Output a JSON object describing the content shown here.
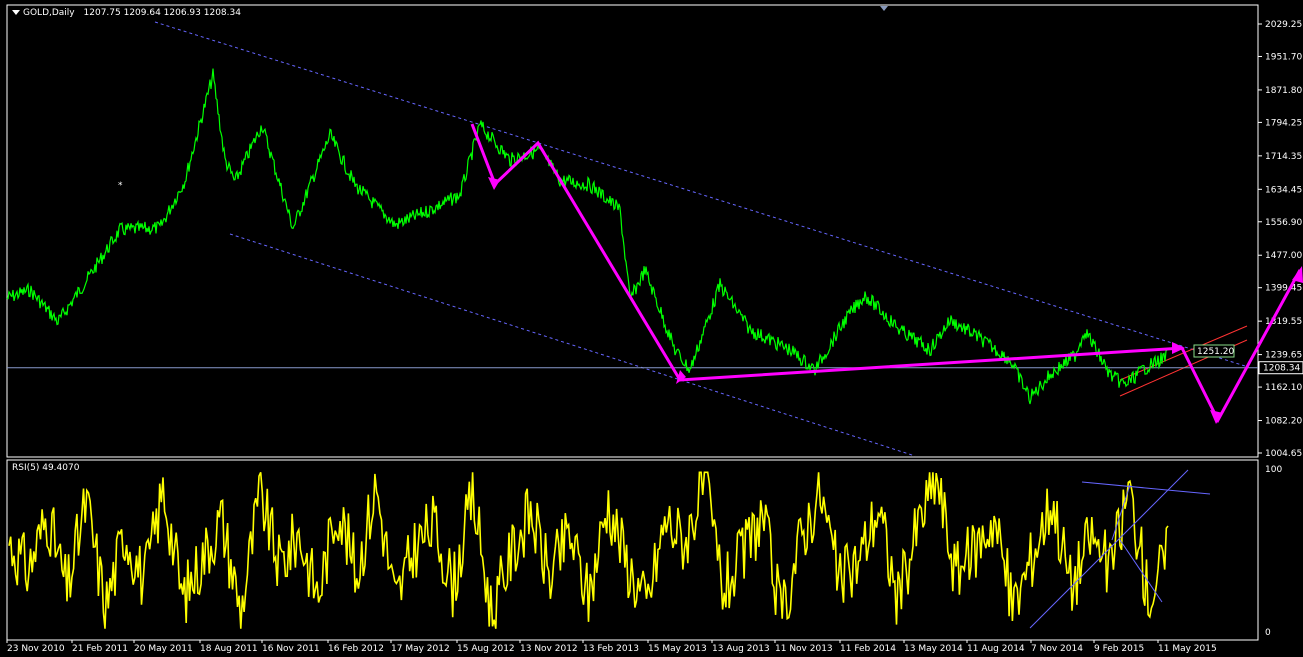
{
  "header": {
    "symbol": "GOLD,Daily",
    "ohlc": "1207.75 1209.64 1206.93 1208.34"
  },
  "indicator": {
    "label": "RSI(5) 49.4070",
    "scale_top": "100",
    "scale_bottom": "0"
  },
  "price_axis": {
    "ticks": [
      "2029.25",
      "1951.70",
      "1871.80",
      "1794.25",
      "1714.35",
      "1634.45",
      "1556.90",
      "1477.00",
      "1399.45",
      "1319.55",
      "1239.65",
      "1162.10",
      "1082.20",
      "1004.65"
    ],
    "current_price": "1208.34",
    "annotation": "1251.20"
  },
  "date_axis": {
    "labels": [
      "23 Nov 2010",
      "21 Feb 2011",
      "20 May 2011",
      "18 Aug 2011",
      "16 Nov 2011",
      "16 Feb 2012",
      "17 May 2012",
      "15 Aug 2012",
      "13 Nov 2012",
      "13 Feb 2013",
      "15 May 2013",
      "13 Aug 2013",
      "11 Nov 2013",
      "11 Feb 2014",
      "13 May 2014",
      "11 Aug 2014",
      "7 Nov 2014",
      "9 Feb 2015",
      "11 May 2015"
    ]
  },
  "colors": {
    "price_line": "#00ff00",
    "rsi_line": "#ffff00",
    "projection": "#ff00ff",
    "channel": "#6666ff",
    "red_channel": "#ff3333",
    "grid_frame": "#ffffff"
  },
  "chart_data": [
    {
      "type": "line",
      "title": "GOLD,Daily",
      "series": [
        {
          "name": "GOLD,Daily",
          "x": [
            "23 Nov 2010",
            "21 Feb 2011",
            "20 May 2011",
            "18 Aug 2011",
            "6 Sep 2011",
            "16 Nov 2011",
            "29 Dec 2011",
            "16 Feb 2012",
            "17 May 2012",
            "15 Aug 2012",
            "5 Oct 2012",
            "13 Nov 2012",
            "13 Feb 2013",
            "15 Apr 2013",
            "15 May 2013",
            "28 Jun 2013",
            "13 Aug 2013",
            "28 Aug 2013",
            "11 Nov 2013",
            "31 Dec 2013",
            "11 Feb 2014",
            "17 Mar 2014",
            "13 May 2014",
            "11 Aug 2014",
            "7 Nov 2014",
            "22 Jan 2015",
            "9 Feb 2015",
            "17 Mar 2015",
            "11 May 2015"
          ],
          "values": [
            1370,
            1400,
            1480,
            1800,
            1900,
            1730,
            1550,
            1740,
            1560,
            1620,
            1790,
            1720,
            1680,
            1420,
            1440,
            1210,
            1300,
            1420,
            1270,
            1200,
            1290,
            1385,
            1300,
            1310,
            1160,
            1295,
            1235,
            1150,
            1208
          ]
        }
      ],
      "ylim": [
        1004.65,
        2029.25
      ]
    },
    {
      "type": "line",
      "title": "RSI(5) 49.4070",
      "series": [
        {
          "name": "RSI(5)",
          "values": [
            55,
            38,
            72,
            25,
            80,
            15,
            62,
            30,
            88,
            20,
            45,
            70,
            12,
            85,
            40,
            60,
            22,
            78,
            35,
            90,
            18,
            52,
            66,
            28,
            84,
            10,
            48,
            74,
            33,
            61,
            21,
            80,
            42,
            16,
            69,
            55,
            92,
            25,
            47,
            72,
            8,
            58,
            86,
            30,
            44,
            77,
            19,
            63,
            95,
            36,
            51,
            70,
            14,
            48,
            82,
            27,
            60,
            38,
            88,
            21,
            49
          ]
        }
      ],
      "ylim": [
        0,
        100
      ]
    }
  ]
}
